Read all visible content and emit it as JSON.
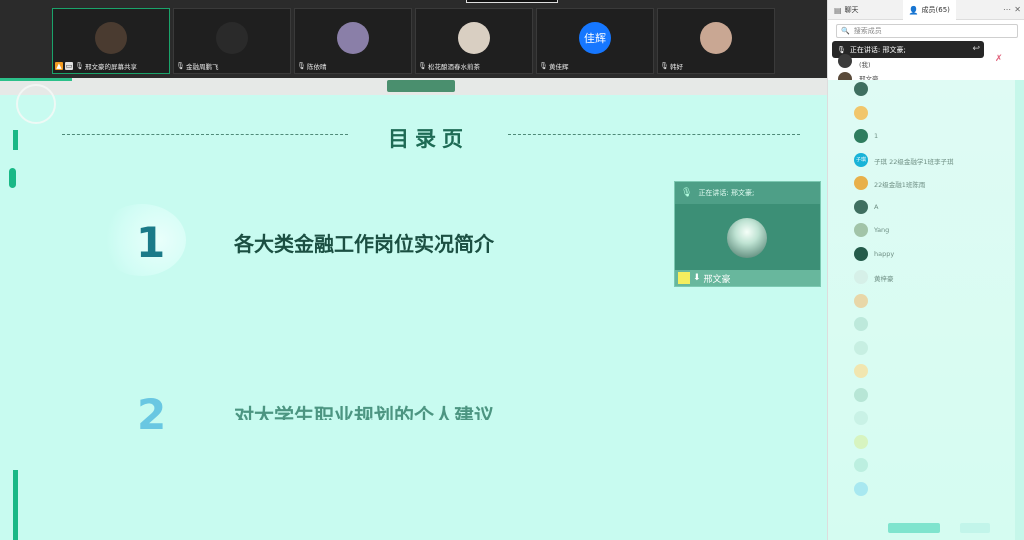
{
  "video_strip": {
    "tiles": [
      {
        "name": "邢文豪的屏幕共享",
        "avatar_color": "#4a3b30",
        "avatar_text": "",
        "active": true
      },
      {
        "name": "金融周鹏飞",
        "avatar_color": "#2a2a2a",
        "avatar_text": ""
      },
      {
        "name": "陈依晴",
        "avatar_color": "#8a7fa8",
        "avatar_text": ""
      },
      {
        "name": "松花酿酒春水煎茶",
        "avatar_color": "#d9cfc2",
        "avatar_text": ""
      },
      {
        "name": "黄佳辉",
        "avatar_color": "#1677ff",
        "avatar_text": "佳辉"
      },
      {
        "name": "韩好",
        "avatar_color": "#c9a793",
        "avatar_text": ""
      }
    ]
  },
  "slide": {
    "title": "目录页",
    "items": [
      {
        "num": "1",
        "text": "各大类金融工作岗位实况简介"
      },
      {
        "num": "2",
        "text": "对大学生职业规划的个人建议"
      }
    ]
  },
  "speaker_window": {
    "header": "正在讲话: 邢文豪;",
    "name": "邢文豪"
  },
  "panel": {
    "tab_chat": "聊天",
    "tab_members": "成员(65)",
    "search_placeholder": "搜索成员",
    "speaking": "正在讲话: 邢文豪;",
    "top_rows": [
      {
        "text": "(我)",
        "color": "#3b3b3b"
      },
      {
        "text": "邢文豪",
        "color": "#5a4a3a"
      }
    ],
    "rows": [
      {
        "text": "",
        "color": "#3f6f60"
      },
      {
        "text": "",
        "color": "#f1c66b"
      },
      {
        "text": "1",
        "color": "#2e7d5e"
      },
      {
        "text": "子琪 22级金融学1班李子琪",
        "color": "#18b3d8",
        "avatar_text": "子琪"
      },
      {
        "text": "22级金融1班陈雨",
        "color": "#e8b04a"
      },
      {
        "text": "A",
        "color": "#3f6f60"
      },
      {
        "text": "Yang",
        "color": "#a2c4a8"
      },
      {
        "text": "happy",
        "color": "#245b4a"
      },
      {
        "text": "黄梓豪",
        "color": "#d6f0e8"
      },
      {
        "text": "",
        "color": "#e8d7a8"
      },
      {
        "text": "",
        "color": "#bde9db"
      },
      {
        "text": "",
        "color": "#c7efe2"
      },
      {
        "text": "",
        "color": "#f1e6b0"
      },
      {
        "text": "",
        "color": "#b7e6d6"
      },
      {
        "text": "",
        "color": "#c9f2e6"
      },
      {
        "text": "",
        "color": "#d7f4c0"
      },
      {
        "text": "",
        "color": "#bcefe0"
      },
      {
        "text": "",
        "color": "#a8e8f0"
      }
    ]
  },
  "colors": {
    "slide_bg": "#c8fbf0",
    "accent_green": "#19b886",
    "title_green": "#1e6b55",
    "num1": "#1a7a88",
    "num2": "#69c7e2"
  }
}
